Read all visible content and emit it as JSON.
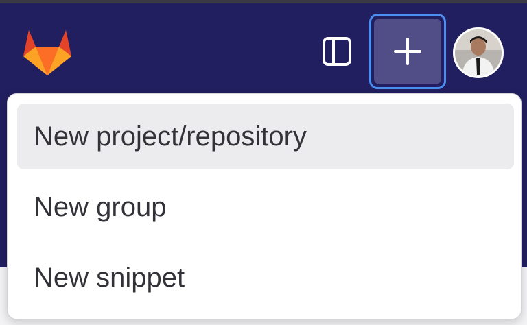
{
  "header": {
    "logo_icon": "gitlab-tanuki-icon",
    "sidebar_toggle_icon": "sidebar-toggle-icon",
    "create_icon": "plus-icon",
    "avatar_icon": "user-avatar",
    "background_color": "#221f60",
    "focus_ring_color": "#4d8ff0"
  },
  "dropdown": {
    "items": [
      {
        "label": "New project/repository",
        "highlighted": true
      },
      {
        "label": "New group",
        "highlighted": false
      },
      {
        "label": "New snippet",
        "highlighted": false
      }
    ]
  }
}
